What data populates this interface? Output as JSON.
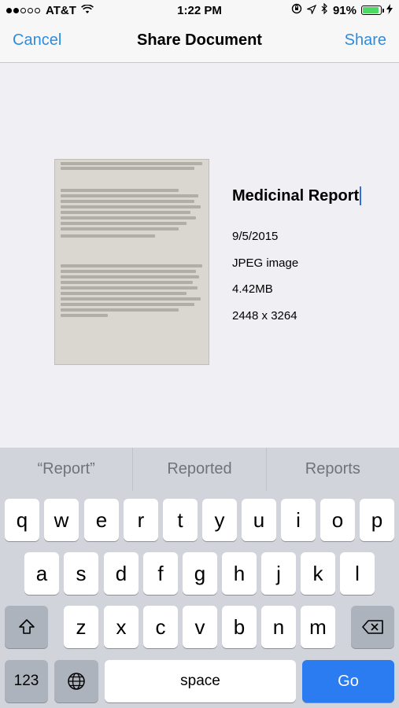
{
  "status_bar": {
    "carrier": "AT&T",
    "time": "1:22 PM",
    "battery_percent": "91%",
    "battery_level": 0.91,
    "signal_bars_filled": 2,
    "signal_bars_total": 5
  },
  "nav": {
    "cancel_label": "Cancel",
    "title": "Share Document",
    "share_label": "Share"
  },
  "document": {
    "name": "Medicinal Report",
    "date": "9/5/2015",
    "type": "JPEG image",
    "size": "4.42MB",
    "dimensions": "2448 x 3264"
  },
  "suggestions": [
    "“Report”",
    "Reported",
    "Reports"
  ],
  "keyboard": {
    "row1": [
      "q",
      "w",
      "e",
      "r",
      "t",
      "y",
      "u",
      "i",
      "o",
      "p"
    ],
    "row2": [
      "a",
      "s",
      "d",
      "f",
      "g",
      "h",
      "j",
      "k",
      "l"
    ],
    "row3": [
      "z",
      "x",
      "c",
      "v",
      "b",
      "n",
      "m"
    ],
    "numbers_label": "123",
    "space_label": "space",
    "go_label": "Go"
  },
  "colors": {
    "accent": "#2f8cdc",
    "go_key": "#2b7cf0",
    "battery": "#4cd964"
  }
}
